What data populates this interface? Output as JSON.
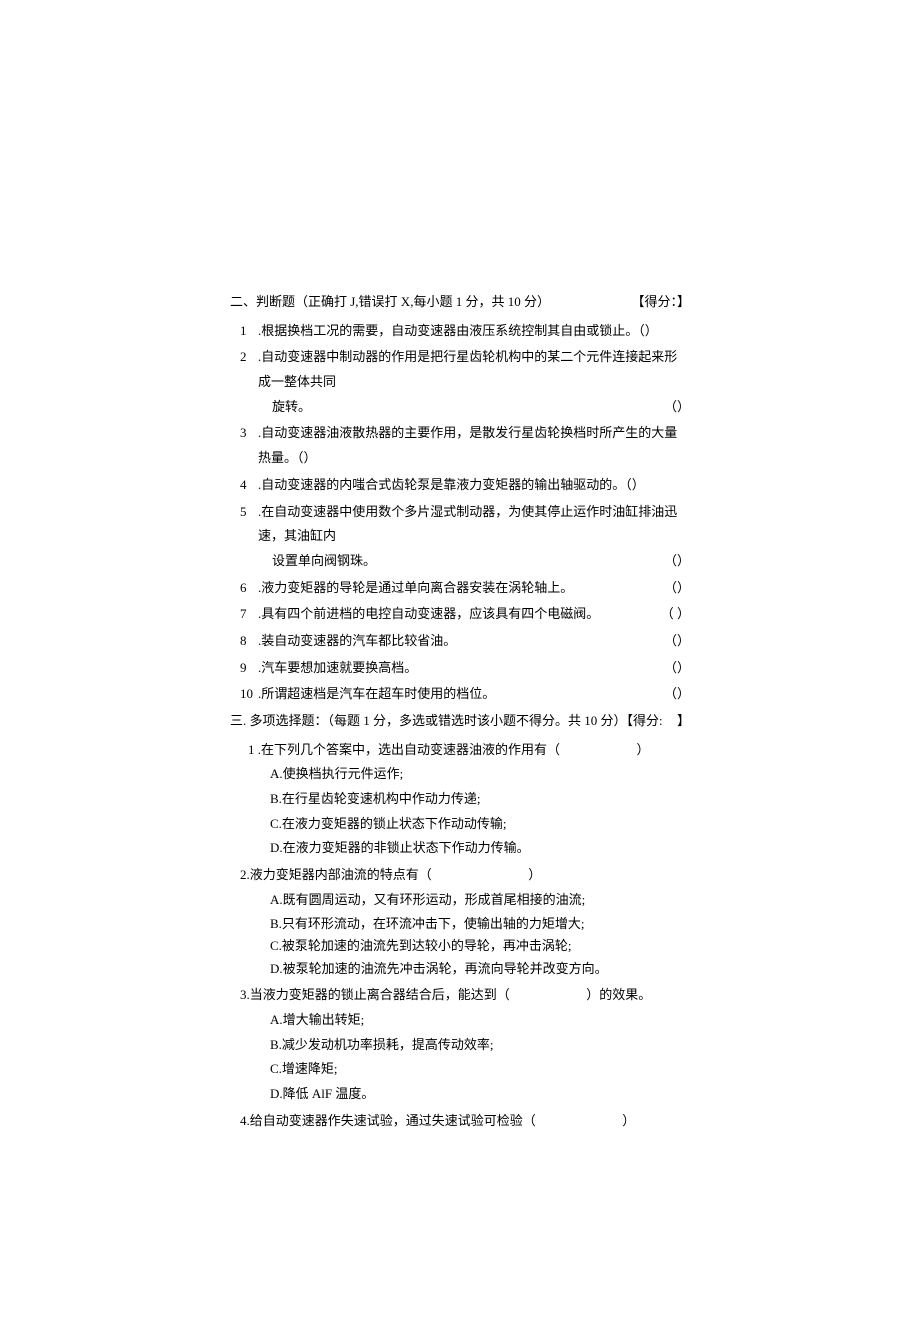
{
  "section2": {
    "title": "二、判断题（正确打 J,错误打 X,每小题 1 分，共 10 分）",
    "score_label": "【得分：】",
    "questions": [
      {
        "num": "1",
        "text": ".根据换档工况的需要，自动变速器由液压系统控制其自由或锁止。（）"
      },
      {
        "num": "2",
        "text": ".自动变速器中制动器的作用是把行星齿轮机构中的某二个元件连接起来形成一整体共同",
        "cont": "旋转。",
        "paren": "（）"
      },
      {
        "num": "3",
        "text": ".自动变速器油液散热器的主要作用，是散发行星齿轮换档时所产生的大量热量。（）"
      },
      {
        "num": "4",
        "text": ".自动变速器的内嗤合式齿轮泵是靠液力变矩器的输出轴驱动的。（）"
      },
      {
        "num": "5",
        "text": ".在自动变速器中使用数个多片湿式制动器，为使其停止运作时油缸排油迅速，其油缸内",
        "cont": "设置单向阀钢珠。",
        "paren": "（）"
      },
      {
        "num": "6",
        "text": ".液力变矩器的导轮是通过单向离合器安装在涡轮轴上。",
        "paren": "（）"
      },
      {
        "num": "7",
        "text": ".具有四个前进档的电控自动变速器，应该具有四个电磁阀。",
        "paren": "（ ）"
      },
      {
        "num": "8",
        "text": ".装自动变速器的汽车都比较省油。",
        "paren": "（）"
      },
      {
        "num": "9",
        "text": ".汽车要想加速就要换高档。",
        "paren": "（）"
      },
      {
        "num": "10",
        "text": ".所谓超速档是汽车在超车时使用的档位。",
        "paren": "（）"
      }
    ]
  },
  "section3": {
    "title": "三. 多项选择题：（每题 1 分，多选或错选时该小题不得分。共 10 分）【得分:",
    "score_bracket": "】",
    "questions": [
      {
        "num": "1",
        "text": ".在下列几个答案中，选出自动变速器油液的作用有（",
        "paren": "）",
        "options": [
          "A.使换档执行元件运作;",
          "B.在行星齿轮变速机构中作动力传递;",
          "C.在液力变矩器的锁止状态下作动动传输;",
          "D.在液力变矩器的非锁止状态下作动力传输。"
        ]
      },
      {
        "num": "2",
        "text": ".液力变矩器内部油流的特点有（",
        "paren": "）",
        "options": [
          "A.既有圆周运动，又有环形运动，形成首尾相接的油流;",
          "B.只有环形流动，在环流冲击下，使输出轴的力矩增大;",
          "C.被泵轮加速的油流先到达较小的导轮，再冲击涡轮;",
          "D.被泵轮加速的油流先冲击涡轮，再流向导轮并改变方向。"
        ]
      },
      {
        "num": "3",
        "text": ".当液力变矩器的锁止离合器结合后，能达到（",
        "paren": "）的效果。",
        "options": [
          "A.增大输出转矩;",
          "B.减少发动机功率损耗，提高传动效率;",
          "C.增速降矩;",
          "D.降低 AlF 温度。"
        ]
      },
      {
        "num": "4",
        "text": ".给自动变速器作失速试验，通过失速试验可检验（",
        "paren": "）",
        "options": []
      }
    ]
  }
}
